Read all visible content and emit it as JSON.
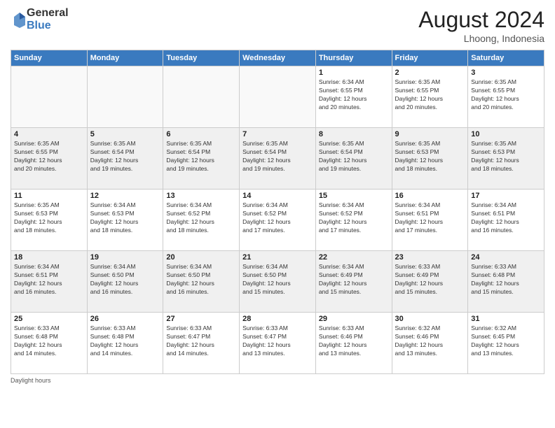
{
  "logo": {
    "general": "General",
    "blue": "Blue"
  },
  "header": {
    "month_year": "August 2024",
    "location": "Lhoong, Indonesia"
  },
  "days_of_week": [
    "Sunday",
    "Monday",
    "Tuesday",
    "Wednesday",
    "Thursday",
    "Friday",
    "Saturday"
  ],
  "footer_text": "Daylight hours",
  "weeks": [
    [
      {
        "day": "",
        "empty": true
      },
      {
        "day": "",
        "empty": true
      },
      {
        "day": "",
        "empty": true
      },
      {
        "day": "",
        "empty": true
      },
      {
        "day": "1",
        "sunrise": "6:34 AM",
        "sunset": "6:55 PM",
        "daylight": "12 hours and 20 minutes."
      },
      {
        "day": "2",
        "sunrise": "6:35 AM",
        "sunset": "6:55 PM",
        "daylight": "12 hours and 20 minutes."
      },
      {
        "day": "3",
        "sunrise": "6:35 AM",
        "sunset": "6:55 PM",
        "daylight": "12 hours and 20 minutes."
      }
    ],
    [
      {
        "day": "4",
        "sunrise": "6:35 AM",
        "sunset": "6:55 PM",
        "daylight": "12 hours and 20 minutes."
      },
      {
        "day": "5",
        "sunrise": "6:35 AM",
        "sunset": "6:54 PM",
        "daylight": "12 hours and 19 minutes."
      },
      {
        "day": "6",
        "sunrise": "6:35 AM",
        "sunset": "6:54 PM",
        "daylight": "12 hours and 19 minutes."
      },
      {
        "day": "7",
        "sunrise": "6:35 AM",
        "sunset": "6:54 PM",
        "daylight": "12 hours and 19 minutes."
      },
      {
        "day": "8",
        "sunrise": "6:35 AM",
        "sunset": "6:54 PM",
        "daylight": "12 hours and 19 minutes."
      },
      {
        "day": "9",
        "sunrise": "6:35 AM",
        "sunset": "6:53 PM",
        "daylight": "12 hours and 18 minutes."
      },
      {
        "day": "10",
        "sunrise": "6:35 AM",
        "sunset": "6:53 PM",
        "daylight": "12 hours and 18 minutes."
      }
    ],
    [
      {
        "day": "11",
        "sunrise": "6:35 AM",
        "sunset": "6:53 PM",
        "daylight": "12 hours and 18 minutes."
      },
      {
        "day": "12",
        "sunrise": "6:34 AM",
        "sunset": "6:53 PM",
        "daylight": "12 hours and 18 minutes."
      },
      {
        "day": "13",
        "sunrise": "6:34 AM",
        "sunset": "6:52 PM",
        "daylight": "12 hours and 18 minutes."
      },
      {
        "day": "14",
        "sunrise": "6:34 AM",
        "sunset": "6:52 PM",
        "daylight": "12 hours and 17 minutes."
      },
      {
        "day": "15",
        "sunrise": "6:34 AM",
        "sunset": "6:52 PM",
        "daylight": "12 hours and 17 minutes."
      },
      {
        "day": "16",
        "sunrise": "6:34 AM",
        "sunset": "6:51 PM",
        "daylight": "12 hours and 17 minutes."
      },
      {
        "day": "17",
        "sunrise": "6:34 AM",
        "sunset": "6:51 PM",
        "daylight": "12 hours and 16 minutes."
      }
    ],
    [
      {
        "day": "18",
        "sunrise": "6:34 AM",
        "sunset": "6:51 PM",
        "daylight": "12 hours and 16 minutes."
      },
      {
        "day": "19",
        "sunrise": "6:34 AM",
        "sunset": "6:50 PM",
        "daylight": "12 hours and 16 minutes."
      },
      {
        "day": "20",
        "sunrise": "6:34 AM",
        "sunset": "6:50 PM",
        "daylight": "12 hours and 16 minutes."
      },
      {
        "day": "21",
        "sunrise": "6:34 AM",
        "sunset": "6:50 PM",
        "daylight": "12 hours and 15 minutes."
      },
      {
        "day": "22",
        "sunrise": "6:34 AM",
        "sunset": "6:49 PM",
        "daylight": "12 hours and 15 minutes."
      },
      {
        "day": "23",
        "sunrise": "6:33 AM",
        "sunset": "6:49 PM",
        "daylight": "12 hours and 15 minutes."
      },
      {
        "day": "24",
        "sunrise": "6:33 AM",
        "sunset": "6:48 PM",
        "daylight": "12 hours and 15 minutes."
      }
    ],
    [
      {
        "day": "25",
        "sunrise": "6:33 AM",
        "sunset": "6:48 PM",
        "daylight": "12 hours and 14 minutes."
      },
      {
        "day": "26",
        "sunrise": "6:33 AM",
        "sunset": "6:48 PM",
        "daylight": "12 hours and 14 minutes."
      },
      {
        "day": "27",
        "sunrise": "6:33 AM",
        "sunset": "6:47 PM",
        "daylight": "12 hours and 14 minutes."
      },
      {
        "day": "28",
        "sunrise": "6:33 AM",
        "sunset": "6:47 PM",
        "daylight": "12 hours and 13 minutes."
      },
      {
        "day": "29",
        "sunrise": "6:33 AM",
        "sunset": "6:46 PM",
        "daylight": "12 hours and 13 minutes."
      },
      {
        "day": "30",
        "sunrise": "6:32 AM",
        "sunset": "6:46 PM",
        "daylight": "12 hours and 13 minutes."
      },
      {
        "day": "31",
        "sunrise": "6:32 AM",
        "sunset": "6:45 PM",
        "daylight": "12 hours and 13 minutes."
      }
    ]
  ]
}
